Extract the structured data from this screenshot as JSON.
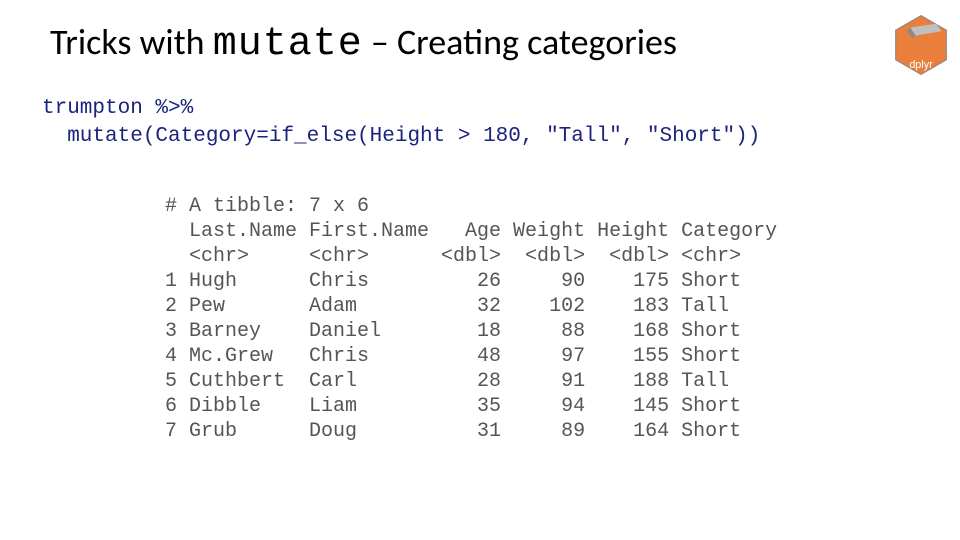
{
  "heading": {
    "pre": "Tricks with ",
    "mono": "mutate",
    "post": " – Creating categories"
  },
  "code": {
    "line1": "trumpton %>%",
    "line2": "  mutate(Category=if_else(Height > 180, \"Tall\", \"Short\"))"
  },
  "output": "# A tibble: 7 x 6\n  Last.Name First.Name   Age Weight Height Category\n  <chr>     <chr>      <dbl>  <dbl>  <dbl> <chr>   \n1 Hugh      Chris         26     90    175 Short   \n2 Pew       Adam          32    102    183 Tall    \n3 Barney    Daniel        18     88    168 Short   \n4 Mc.Grew   Chris         48     97    155 Short   \n5 Cuthbert  Carl          28     91    188 Tall    \n6 Dibble    Liam          35     94    145 Short   \n7 Grub      Doug          31     89    164 Short   ",
  "logo": {
    "label": "dplyr"
  }
}
